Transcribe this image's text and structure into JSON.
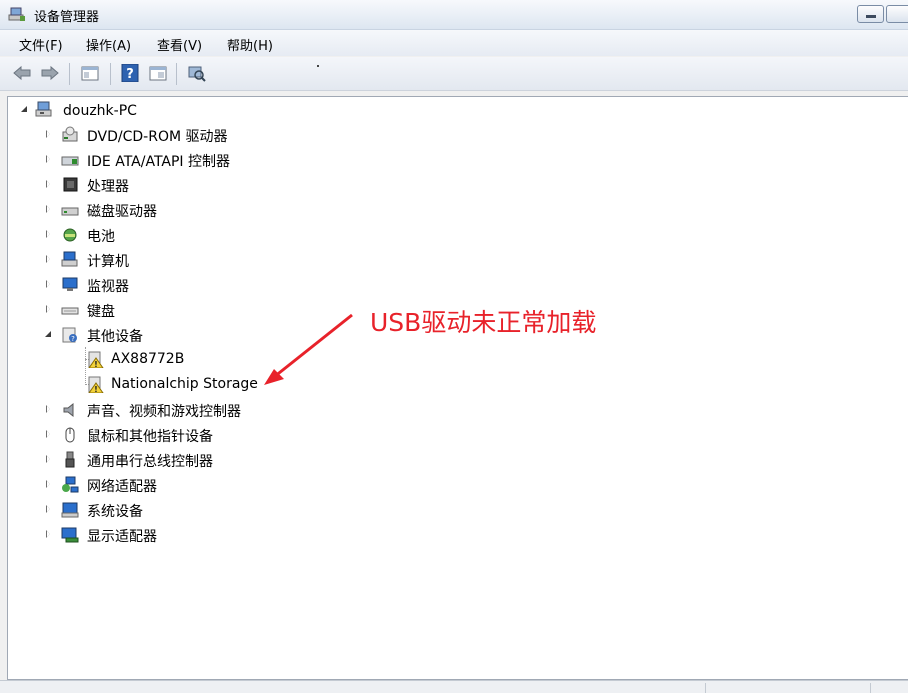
{
  "window": {
    "title": "设备管理器"
  },
  "menu": [
    {
      "label": "文件(F)"
    },
    {
      "label": "操作(A)"
    },
    {
      "label": "查看(V)"
    },
    {
      "label": "帮助(H)"
    }
  ],
  "toolbar": {
    "buttons": [
      "back-icon",
      "forward-icon",
      "properties-icon",
      "help-icon",
      "show-hide-icon",
      "scan-hardware-icon"
    ]
  },
  "tree": {
    "root": {
      "label": "douzhk-PC",
      "icon": "computer-icon"
    },
    "categories": [
      {
        "label": "DVD/CD-ROM 驱动器",
        "icon": "dvd-drive-icon",
        "expanded": false
      },
      {
        "label": "IDE ATA/ATAPI 控制器",
        "icon": "ide-controller-icon",
        "expanded": false
      },
      {
        "label": "处理器",
        "icon": "processor-icon",
        "expanded": false
      },
      {
        "label": "磁盘驱动器",
        "icon": "disk-drive-icon",
        "expanded": false
      },
      {
        "label": "电池",
        "icon": "battery-icon",
        "expanded": false
      },
      {
        "label": "计算机",
        "icon": "computer-icon",
        "expanded": false
      },
      {
        "label": "监视器",
        "icon": "monitor-icon",
        "expanded": false
      },
      {
        "label": "键盘",
        "icon": "keyboard-icon",
        "expanded": false
      },
      {
        "label": "其他设备",
        "icon": "other-devices-icon",
        "expanded": true,
        "children": [
          {
            "label": "AX88772B",
            "icon": "warning-device-icon"
          },
          {
            "label": "Nationalchip Storage",
            "icon": "warning-device-icon"
          }
        ]
      },
      {
        "label": "声音、视频和游戏控制器",
        "icon": "sound-icon",
        "expanded": false
      },
      {
        "label": "鼠标和其他指针设备",
        "icon": "mouse-icon",
        "expanded": false
      },
      {
        "label": "通用串行总线控制器",
        "icon": "usb-icon",
        "expanded": false
      },
      {
        "label": "网络适配器",
        "icon": "network-icon",
        "expanded": false
      },
      {
        "label": "系统设备",
        "icon": "system-device-icon",
        "expanded": false
      },
      {
        "label": "显示适配器",
        "icon": "display-adapter-icon",
        "expanded": false
      }
    ]
  },
  "annotation": {
    "text": "USB驱动未正常加载",
    "color": "#e8222a"
  }
}
